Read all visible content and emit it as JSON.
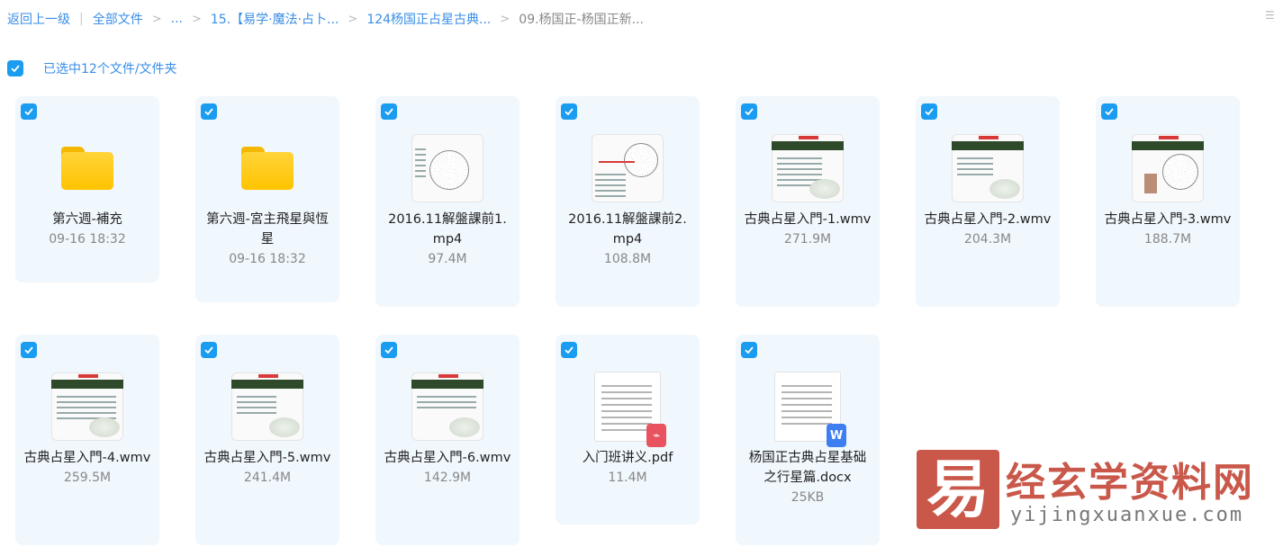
{
  "breadcrumb": {
    "back": "返回上一级",
    "root": "全部文件",
    "ellipsis": "...",
    "items": [
      "15.【易学·魔法·占卜...",
      "124杨国正占星古典...",
      "09.杨国正-杨国正新..."
    ]
  },
  "selection": {
    "label": "已选中12个文件/文件夹"
  },
  "files": [
    {
      "name": "第六週-補充",
      "meta": "09-16 18:32",
      "type": "folder"
    },
    {
      "name": "第六週-宮主飛星與恆星",
      "meta": "09-16 18:32",
      "type": "folder"
    },
    {
      "name": "2016.11解盤課前1.mp4",
      "meta": "97.4M",
      "type": "video"
    },
    {
      "name": "2016.11解盤課前2.mp4",
      "meta": "108.8M",
      "type": "video"
    },
    {
      "name": "古典占星入門-1.wmv",
      "meta": "271.9M",
      "type": "video"
    },
    {
      "name": "古典占星入門-2.wmv",
      "meta": "204.3M",
      "type": "video"
    },
    {
      "name": "古典占星入門-3.wmv",
      "meta": "188.7M",
      "type": "video"
    },
    {
      "name": "古典占星入門-4.wmv",
      "meta": "259.5M",
      "type": "video"
    },
    {
      "name": "古典占星入門-5.wmv",
      "meta": "241.4M",
      "type": "video"
    },
    {
      "name": "古典占星入門-6.wmv",
      "meta": "142.9M",
      "type": "video"
    },
    {
      "name": "入门班讲义.pdf",
      "meta": "11.4M",
      "type": "pdf"
    },
    {
      "name": "杨国正古典占星基础之行星篇.docx",
      "meta": "25KB",
      "type": "docx"
    }
  ],
  "watermark": {
    "logo": "易",
    "title": "经玄学资料网",
    "url": "yijingxuanxue.com"
  },
  "colors": {
    "accent": "#1a9cf0",
    "link": "#3a8ee6",
    "card": "#f0f7fd",
    "watermark": "#c9584a"
  }
}
